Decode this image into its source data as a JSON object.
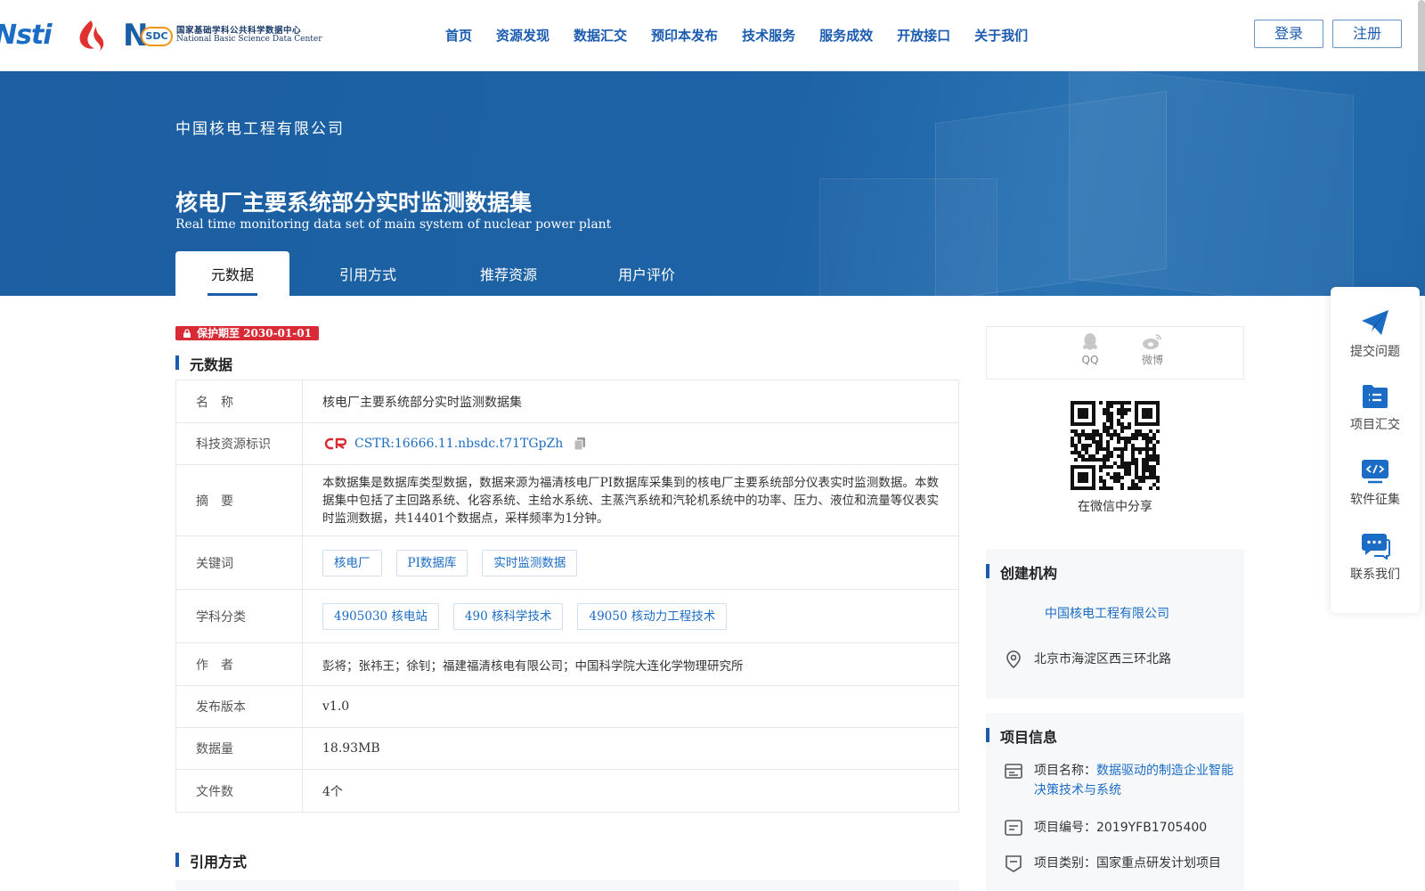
{
  "header": {
    "logo_nsti": "Nsti",
    "logo_nsdc": {
      "n": "N",
      "sdc": "SDC",
      "cn": "国家基础学科公共科学数据中心",
      "en": "National Basic Science Data Center"
    },
    "nav": [
      "首页",
      "资源发现",
      "数据汇交",
      "预印本发布",
      "技术服务",
      "服务成效",
      "开放接口",
      "关于我们"
    ],
    "login": "登录",
    "register": "注册"
  },
  "banner": {
    "org": "中国核电工程有限公司",
    "title_cn": "核电厂主要系统部分实时监测数据集",
    "title_en": "Real time monitoring data set of main system of nuclear power plant",
    "tabs": [
      "元数据",
      "引用方式",
      "推荐资源",
      "用户评价"
    ]
  },
  "main": {
    "badge": "保护期至 2030-01-01",
    "section_meta": "元数据",
    "section_cite": "引用方式",
    "meta": {
      "name_label": "名　称",
      "name_value": "核电厂主要系统部分实时监测数据集",
      "cstr_label": "科技资源标识",
      "cstr_value": "CSTR:16666.11.nbsdc.t71TGpZh",
      "abstract_label": "摘　要",
      "abstract_value": "本数据集是数据库类型数据，数据来源为福清核电厂PI数据库采集到的核电厂主要系统部分仪表实时监测数据。本数据集中包括了主回路系统、化容系统、主给水系统、主蒸汽系统和汽轮机系统中的功率、压力、液位和流量等仪表实时监测数据，共14401个数据点，采样频率为1分钟。",
      "keywords_label": "关键词",
      "keywords": [
        "核电厂",
        "PI数据库",
        "实时监测数据"
      ],
      "subject_label": "学科分类",
      "subjects": [
        "4905030 核电站",
        "490 核科学技术",
        "49050 核动力工程技术"
      ],
      "author_label": "作　者",
      "author_value": "彭将；张祎王；徐钊；福建福清核电有限公司；中国科学院大连化学物理研究所",
      "version_label": "发布版本",
      "version_value": "v1.0",
      "size_label": "数据量",
      "size_value": "18.93MB",
      "files_label": "文件数",
      "files_value": "4个"
    }
  },
  "right": {
    "share_qq": "QQ",
    "share_weibo": "微博",
    "qr_label": "在微信中分享",
    "org_title": "创建机构",
    "org_name": "中国核电工程有限公司",
    "org_address": "北京市海淀区西三环北路",
    "project_title": "项目信息",
    "project_name_label": "项目名称：",
    "project_name_value": "数据驱动的制造企业智能决策技术与系统",
    "project_no_label": "项目编号：",
    "project_no_value": "2019YFB1705400",
    "project_type_label": "项目类别：",
    "project_type_value": "国家重点研发计划项目"
  },
  "float": [
    "提交问题",
    "项目汇交",
    "软件征集",
    "联系我们"
  ],
  "colors": {
    "primary": "#1b5bb0",
    "banner": "#1d62a6",
    "badge": "#d92b35"
  }
}
